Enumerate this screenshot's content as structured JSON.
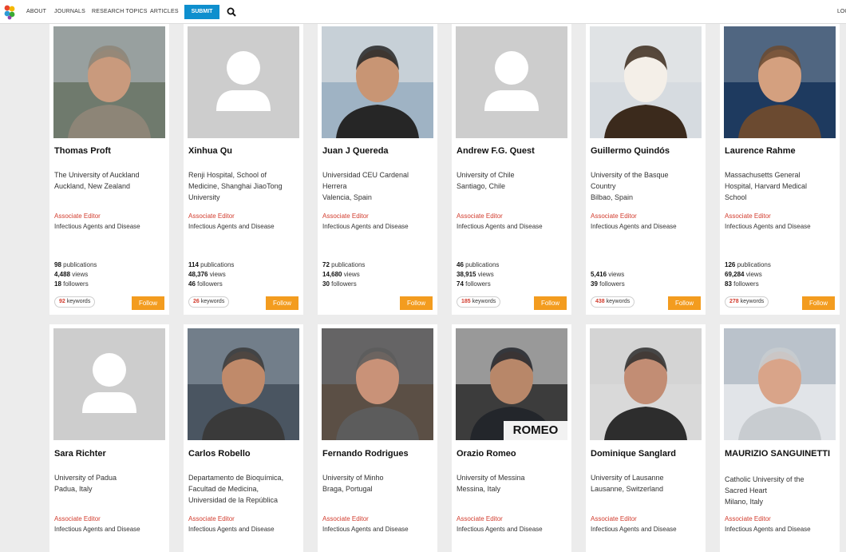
{
  "nav": {
    "items": [
      "ABOUT",
      "JOURNALS",
      "RESEARCH TOPICS",
      "ARTICLES"
    ],
    "submit_label": "SUBMIT",
    "login_label": "LOGIN",
    "logo_icon": "frontiers-logo-icon",
    "search_icon": "search-icon",
    "accent_color": "#0e8fce"
  },
  "colors": {
    "role": "#d23c2e",
    "follow": "#f39c1f",
    "background": "#ececec"
  },
  "profiles": [
    {
      "name": "Thomas Proft",
      "affiliation": [
        "The University of Auckland",
        "Auckland, New Zealand"
      ],
      "role": "Associate Editor",
      "specialty": "Infectious Agents and Disease",
      "publications": "98",
      "views": "4,488",
      "followers": "18",
      "keywords": "92",
      "photo": "photo"
    },
    {
      "name": "Xinhua Qu",
      "affiliation": [
        "Renji Hospital, School of",
        "Medicine, Shanghai JiaoTong",
        "University"
      ],
      "role": "Associate Editor",
      "specialty": "Infectious Agents and Disease",
      "publications": "114",
      "views": "48,376",
      "followers": "46",
      "keywords": "26",
      "photo": "placeholder"
    },
    {
      "name": "Juan J Quereda",
      "affiliation": [
        "Universidad CEU Cardenal",
        "Herrera",
        "Valencia, Spain"
      ],
      "role": "Associate Editor",
      "specialty": "Infectious Agents and Disease",
      "publications": "72",
      "views": "14,680",
      "followers": "30",
      "keywords": "",
      "photo": "photo"
    },
    {
      "name": "Andrew F.G. Quest",
      "affiliation": [
        "University of Chile",
        "Santiago, Chile"
      ],
      "role": "Associate Editor",
      "specialty": "Infectious Agents and Disease",
      "publications": "46",
      "views": "38,915",
      "followers": "74",
      "keywords": "185",
      "photo": "placeholder"
    },
    {
      "name": "Guillermo Quindós",
      "affiliation": [
        "University of the Basque",
        "Country",
        "Bilbao, Spain"
      ],
      "role": "Associate Editor",
      "specialty": "Infectious Agents and Disease",
      "publications": "",
      "views": "5,416",
      "followers": "39",
      "keywords": "438",
      "photo": "photo"
    },
    {
      "name": "Laurence Rahme",
      "affiliation": [
        "Massachusetts General",
        "Hospital, Harvard Medical",
        "School"
      ],
      "role": "Associate Editor",
      "specialty": "Infectious Agents and Disease",
      "publications": "126",
      "views": "69,284",
      "followers": "83",
      "keywords": "278",
      "photo": "photo"
    },
    {
      "name": "Sara Richter",
      "affiliation": [
        "University of Padua",
        "Padua, Italy"
      ],
      "role": "Associate Editor",
      "specialty": "Infectious Agents and Disease",
      "photo": "placeholder"
    },
    {
      "name": "Carlos Robello",
      "affiliation": [
        "Departamento de Bioquímica,",
        "Facultad de Medicina,",
        "Universidad de la República"
      ],
      "role": "Associate Editor",
      "specialty": "Infectious Agents and Disease",
      "photo": "photo"
    },
    {
      "name": "Fernando Rodrigues",
      "affiliation": [
        "University of Minho",
        "Braga, Portugal"
      ],
      "role": "Associate Editor",
      "specialty": "Infectious Agents and Disease",
      "photo": "photo"
    },
    {
      "name": "Orazio Romeo",
      "affiliation": [
        "University of Messina",
        "Messina, Italy"
      ],
      "role": "Associate Editor",
      "specialty": "Infectious Agents and Disease",
      "photo": "photo",
      "photo_caption": "ROMEO"
    },
    {
      "name": "Dominique Sanglard",
      "affiliation": [
        "University of Lausanne",
        "Lausanne, Switzerland"
      ],
      "role": "Associate Editor",
      "specialty": "Infectious Agents and Disease",
      "photo": "photo"
    },
    {
      "name": "MAURIZIO SANGUINETTI",
      "affiliation": [
        "Catholic University of the",
        "Sacred Heart",
        "Milano, Italy"
      ],
      "role": "Associate Editor",
      "specialty": "Infectious Agents and Disease",
      "photo": "photo"
    }
  ],
  "labels": {
    "publications": "publications",
    "views": "views",
    "followers": "followers",
    "keywords": "keywords",
    "follow": "Follow"
  }
}
